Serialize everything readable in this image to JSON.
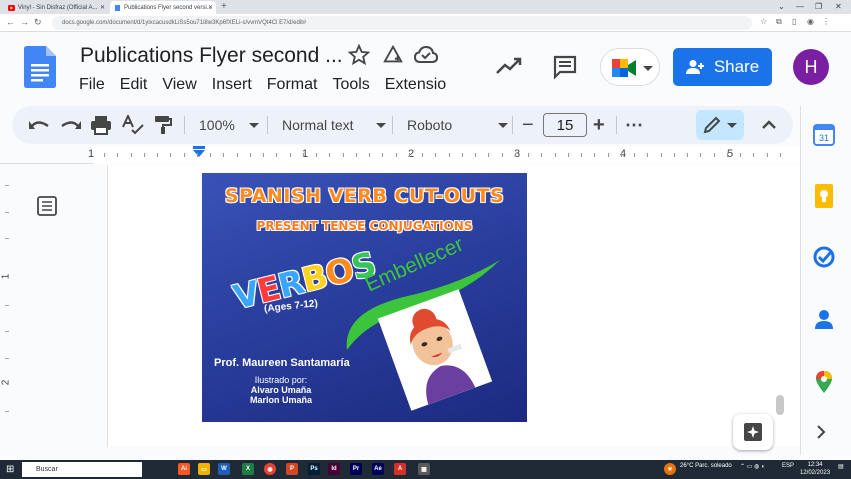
{
  "browser": {
    "tabs": [
      {
        "label": "Vinyl - Sin Disfraz (Official A...",
        "active": false
      },
      {
        "label": "Publications Flyer second versi...",
        "active": true
      }
    ],
    "url": "docs.google.com/document/d/1yixcacusdkLiSs5ou71i8w3Kp6fXELi-s/vvmVQt4Cl E7/d/edit#"
  },
  "docs": {
    "title": "Publications Flyer second ...",
    "menu": [
      "File",
      "Edit",
      "View",
      "Insert",
      "Format",
      "Tools",
      "Extensio"
    ],
    "share_label": "Share",
    "avatar_initial": "H"
  },
  "toolbar": {
    "zoom": "100%",
    "style": "Normal text",
    "font": "Roboto",
    "font_size": "15",
    "more": "⋯"
  },
  "ruler": {
    "labels": [
      "1",
      "1",
      "2",
      "3",
      "4",
      "5"
    ],
    "vertical_labels": [
      "1",
      "2"
    ]
  },
  "flyer": {
    "title": "SPANISH VERB CUT-OUTS",
    "subtitle": "PRESENT TENSE CONJUGATIONS",
    "verbos_letters": [
      "V",
      "E",
      "R",
      "B",
      "O",
      "S"
    ],
    "ages": "(Ages 7-12)",
    "embellecer": "Embellecer",
    "author": "Prof. Maureen Santamaría",
    "illustrated_by": "Ilustrado por:",
    "illustrators": [
      "Alvaro Umaña",
      "Marlon Umaña"
    ]
  },
  "taskbar": {
    "search_label": "Buscar",
    "weather": "26°C  Parc. soleado",
    "lang": "ESP",
    "time": "12:34",
    "date": "12/02/2023"
  },
  "colors": {
    "share_blue": "#1a73e8",
    "avatar_purple": "#7b1fa2",
    "flyer_orange": "#ff8a1e",
    "flyer_green": "#3cc43c",
    "flyer_blue": "#2a3f9e"
  }
}
